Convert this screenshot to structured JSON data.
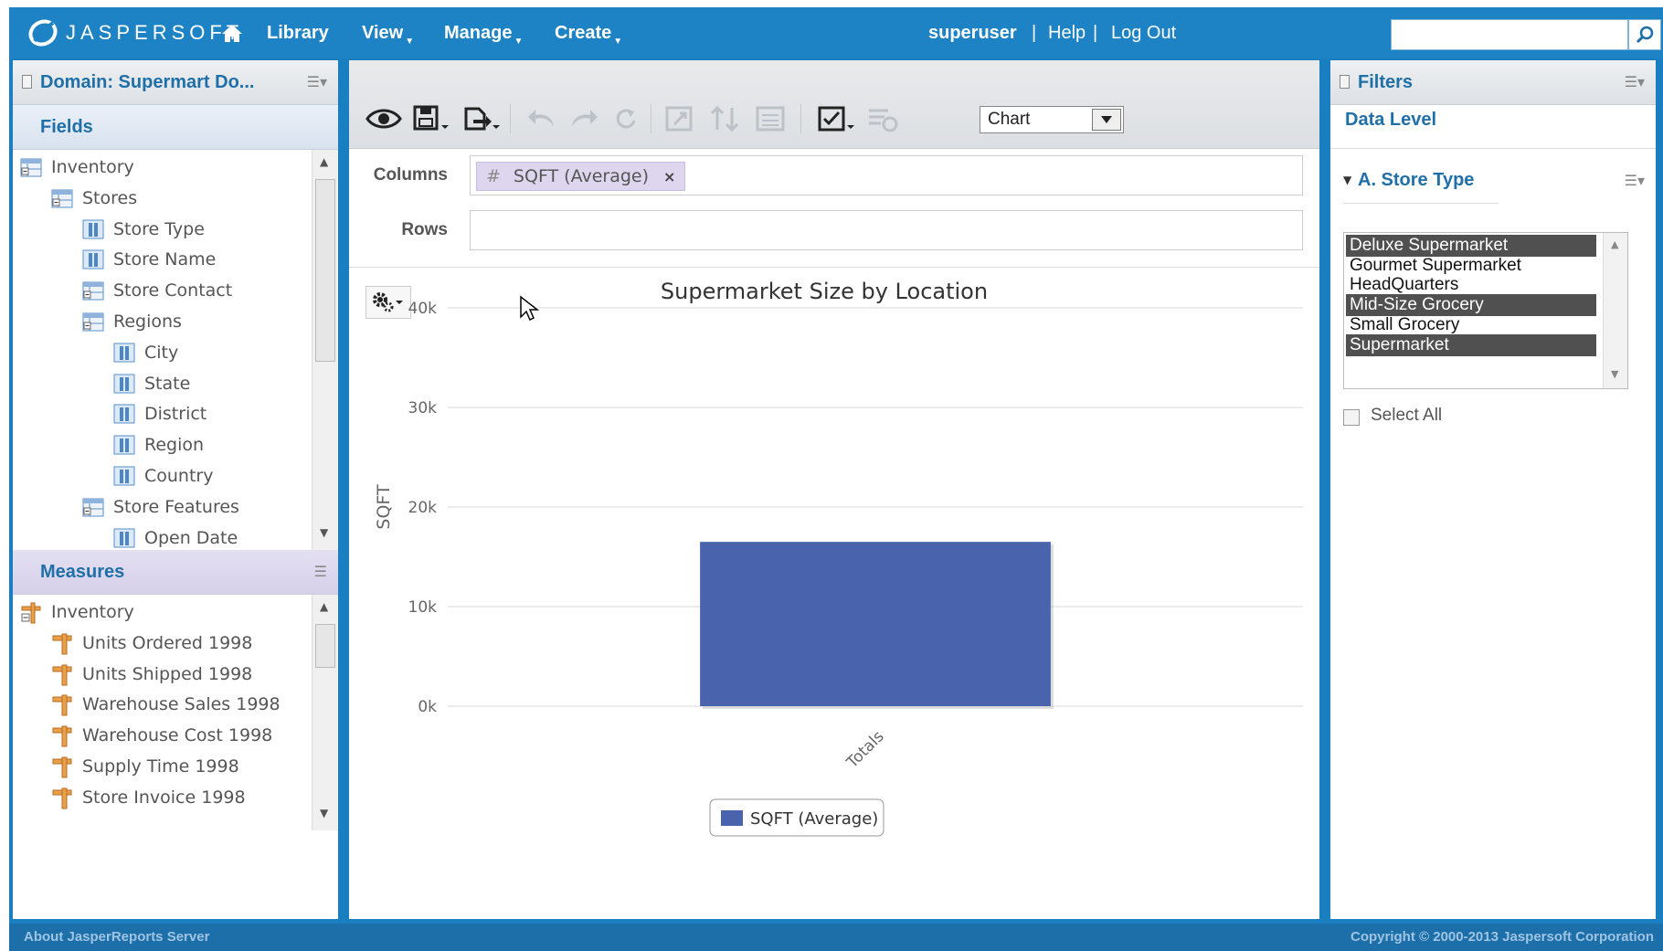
{
  "header": {
    "logo_text": "JASPERSOFT",
    "nav": {
      "library": "Library",
      "view": "View",
      "manage": "Manage",
      "create": "Create"
    },
    "user": "superuser",
    "help": "Help",
    "logout": "Log Out",
    "sep": "|",
    "search_value": ""
  },
  "left": {
    "domain_title": "Domain: Supermart Do...",
    "fields_label": "Fields",
    "fields": [
      {
        "label": "Inventory",
        "icon": "table-group-icon"
      },
      {
        "label": "Stores",
        "icon": "table-group-icon"
      },
      {
        "label": "Store Type",
        "icon": "field-icon"
      },
      {
        "label": "Store Name",
        "icon": "field-icon"
      },
      {
        "label": "Store Contact",
        "icon": "table-group-icon"
      },
      {
        "label": "Regions",
        "icon": "table-group-icon"
      },
      {
        "label": "City",
        "icon": "field-icon"
      },
      {
        "label": "State",
        "icon": "field-icon"
      },
      {
        "label": "District",
        "icon": "field-icon"
      },
      {
        "label": "Region",
        "icon": "field-icon"
      },
      {
        "label": "Country",
        "icon": "field-icon"
      },
      {
        "label": "Store Features",
        "icon": "table-group-icon"
      },
      {
        "label": "Open Date",
        "icon": "field-icon"
      }
    ],
    "measures_label": "Measures",
    "measures": [
      {
        "label": "Inventory",
        "icon": "measure-group-icon"
      },
      {
        "label": "Units Ordered 1998",
        "icon": "measure-icon"
      },
      {
        "label": "Units Shipped 1998",
        "icon": "measure-icon"
      },
      {
        "label": "Warehouse Sales 1998",
        "icon": "measure-icon"
      },
      {
        "label": "Warehouse Cost 1998",
        "icon": "measure-icon"
      },
      {
        "label": "Supply Time 1998",
        "icon": "measure-icon"
      },
      {
        "label": "Store Invoice 1998",
        "icon": "measure-icon"
      }
    ]
  },
  "center": {
    "view_type": "Chart",
    "columns_label": "Columns",
    "rows_label": "Rows",
    "column_chip": {
      "hash": "#",
      "label": "SQFT (Average)",
      "remove": "×"
    }
  },
  "chart_data": {
    "type": "bar",
    "title": "Supermarket Size by Location",
    "xlabel": "",
    "ylabel": "SQFT",
    "categories": [
      "Totals"
    ],
    "series": [
      {
        "name": "SQFT (Average)",
        "values": [
          16500
        ]
      }
    ],
    "ylim": [
      0,
      40000
    ],
    "yticks": [
      "0k",
      "10k",
      "20k",
      "30k",
      "40k"
    ],
    "grid": true,
    "legend": "bottom",
    "color": "#4a63ad"
  },
  "right": {
    "filters_label": "Filters",
    "data_level_label": "Data Level",
    "filter_title": "A. Store Type",
    "options": [
      {
        "label": "Deluxe Supermarket",
        "selected": true
      },
      {
        "label": "Gourmet Supermarket",
        "selected": false
      },
      {
        "label": "HeadQuarters",
        "selected": false
      },
      {
        "label": "Mid-Size Grocery",
        "selected": true
      },
      {
        "label": "Small Grocery",
        "selected": false
      },
      {
        "label": "Supermarket",
        "selected": true
      }
    ],
    "select_all_label": "Select All"
  },
  "footer": {
    "about": "About JasperReports Server",
    "copyright": "Copyright © 2000-2013 Jaspersoft Corporation"
  }
}
